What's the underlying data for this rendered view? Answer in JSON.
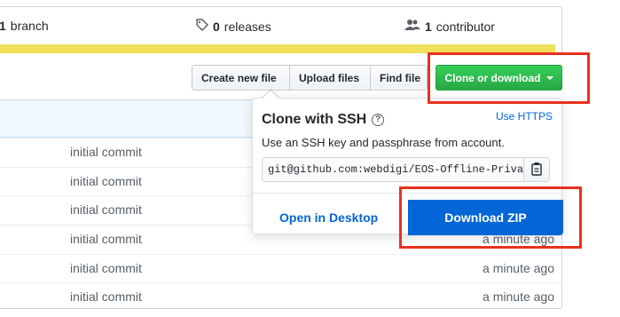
{
  "summary": {
    "branch": {
      "count": "1",
      "label": "branch"
    },
    "releases": {
      "count": "0",
      "label": "releases"
    },
    "contributors": {
      "count": "1",
      "label": "contributor"
    },
    "language_color": "#f1e05a"
  },
  "toolbar": {
    "create_new_file": "Create new file",
    "upload_files": "Upload files",
    "find_file": "Find file",
    "clone_or_download": "Clone or download"
  },
  "files": {
    "rows": [
      {
        "message": "initial commit",
        "age": ""
      },
      {
        "message": "initial commit",
        "age": ""
      },
      {
        "message": "initial commit",
        "age": ""
      },
      {
        "message": "initial commit",
        "age": "a minute ago"
      },
      {
        "message": "initial commit",
        "age": "a minute ago"
      },
      {
        "message": "initial commit",
        "age": "a minute ago"
      }
    ]
  },
  "clone_popover": {
    "title": "Clone with SSH",
    "help_icon": "question-icon",
    "switch_link": "Use HTTPS",
    "description": "Use an SSH key and passphrase from account.",
    "url": "git@github.com:webdigi/EOS-Offline-Private",
    "copy_icon": "clipboard-icon",
    "open_in_desktop": "Open in Desktop",
    "download_zip": "Download ZIP"
  },
  "colors": {
    "accent_green": "#28a745",
    "link_blue": "#0366d6",
    "highlight_red": "#e8311f"
  }
}
